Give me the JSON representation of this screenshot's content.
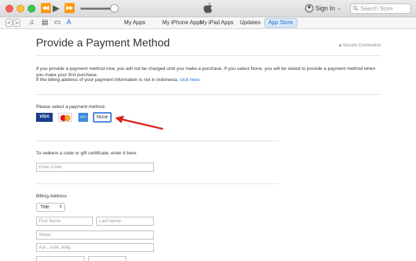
{
  "titlebar": {
    "signin_label": "Sign In",
    "search_placeholder": "Search Store",
    "playback": [
      "⏪",
      "▶",
      "⏩"
    ]
  },
  "toolbar": {
    "back": "<",
    "forward": ">",
    "tabs": [
      {
        "label": "My Apps"
      },
      {
        "label": "My iPhone Apps"
      },
      {
        "label": "My iPad Apps"
      },
      {
        "label": "Updates"
      },
      {
        "label": "App Store",
        "active": true
      }
    ]
  },
  "page": {
    "title": "Provide a Payment Method",
    "secure_label": "Secure Connection",
    "intro_text": "If you provide a payment method now, you will not be charged until you make a purchase. If you select None, you will be asked to provide a payment method when you make your first purchase.",
    "billing_note": "If the billing address of your payment information is not in Indonesia,",
    "billing_link": "click here",
    "select_prompt": "Please select a payment method.",
    "card_visa": "VISA",
    "card_amex": "AMEX",
    "none_label": "None",
    "redeem_prompt": "To redeem a code or gift certificate, enter it here.",
    "code_placeholder": "Enter Code",
    "billing_heading": "Billing Address",
    "title_select": "Title",
    "first_name": "First Name",
    "last_name": "Last Name",
    "street": "Street",
    "apt": "Apt., suite, bldg."
  },
  "colors": {
    "accent": "#1b6fdc",
    "arrow": "#e0201b",
    "visa": "#1a3e8c"
  }
}
